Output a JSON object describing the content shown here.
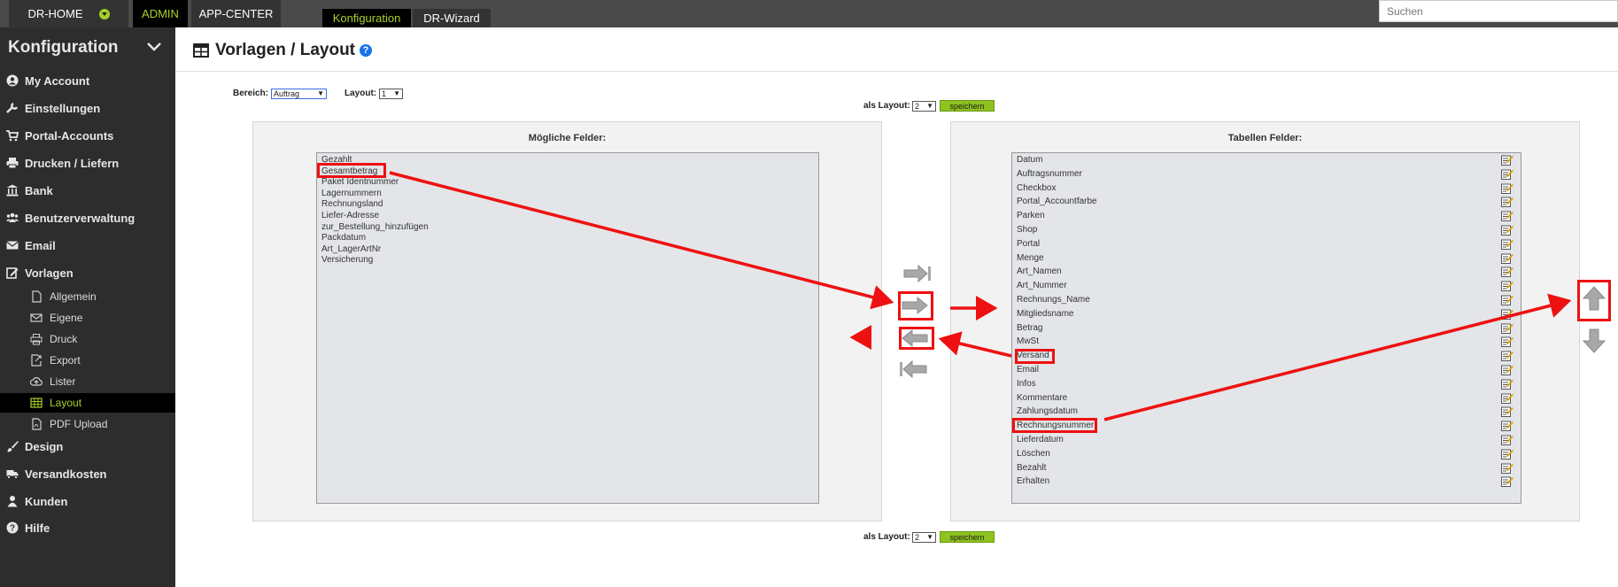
{
  "topbar": {
    "dr_home": "DR-HOME",
    "admin": "ADMIN",
    "app_center": "APP-CENTER",
    "konfiguration_tab": "Konfiguration",
    "dr_wizard_tab": "DR-Wizard",
    "search_placeholder": "Suchen"
  },
  "sidebar": {
    "title": "Konfiguration",
    "items": [
      {
        "label": "My Account",
        "icon": "user-circle-icon"
      },
      {
        "label": "Einstellungen",
        "icon": "wrench-icon"
      },
      {
        "label": "Portal-Accounts",
        "icon": "shopping-cart-icon"
      },
      {
        "label": "Drucken / Liefern",
        "icon": "printer-icon"
      },
      {
        "label": "Bank",
        "icon": "bank-icon"
      },
      {
        "label": "Benutzerverwaltung",
        "icon": "users-icon"
      },
      {
        "label": "Email",
        "icon": "envelope-icon"
      },
      {
        "label": "Vorlagen",
        "icon": "edit-icon"
      }
    ],
    "subitems": [
      {
        "label": "Allgemein",
        "icon": "file-icon"
      },
      {
        "label": "Eigene",
        "icon": "envelope-outline-icon"
      },
      {
        "label": "Druck",
        "icon": "printer-outline-icon"
      },
      {
        "label": "Export",
        "icon": "export-icon"
      },
      {
        "label": "Lister",
        "icon": "cloud-upload-icon"
      },
      {
        "label": "Layout",
        "icon": "table-icon"
      },
      {
        "label": "PDF Upload",
        "icon": "file-pdf-icon"
      }
    ],
    "items_after": [
      {
        "label": "Design",
        "icon": "brush-icon"
      },
      {
        "label": "Versandkosten",
        "icon": "truck-icon"
      },
      {
        "label": "Kunden",
        "icon": "user-icon"
      },
      {
        "label": "Hilfe",
        "icon": "question-circle-icon"
      }
    ]
  },
  "header": {
    "title": "Vorlagen / Layout"
  },
  "controls": {
    "bereich_label": "Bereich:",
    "bereich_value": "Auftrag",
    "layout_label": "Layout:",
    "layout_value": "1",
    "als_layout_label": "als Layout:",
    "als_layout_value": "2",
    "save_label": "speichern"
  },
  "left_panel": {
    "title": "Mögliche Felder:",
    "fields": [
      "Gezahlt",
      "Gesamtbetrag",
      "Paket Identnummer",
      "Lagernummern",
      "Rechnungsland",
      "Liefer-Adresse",
      "zur_Bestellung_hinzufügen",
      "Packdatum",
      "Art_LagerArtNr",
      "Versicherung"
    ]
  },
  "right_panel": {
    "title": "Tabellen Felder:",
    "fields": [
      "Datum",
      "Auftragsnummer",
      "Checkbox",
      "Portal_Accountfarbe",
      "Parken",
      "Shop",
      "Portal",
      "Menge",
      "Art_Namen",
      "Art_Nummer",
      "Rechnungs_Name",
      "Mitgliedsname",
      "Betrag",
      "MwSt",
      "Versand",
      "Email",
      "Infos",
      "Kommentare",
      "Zahlungsdatum",
      "Rechnungsnummer",
      "Lieferdatum",
      "Löschen",
      "Bezahlt",
      "Erhalten"
    ]
  },
  "colors": {
    "accent": "#a5d02a",
    "annotation": "#ee1111",
    "sidebar_bg": "#2d2d2d"
  }
}
